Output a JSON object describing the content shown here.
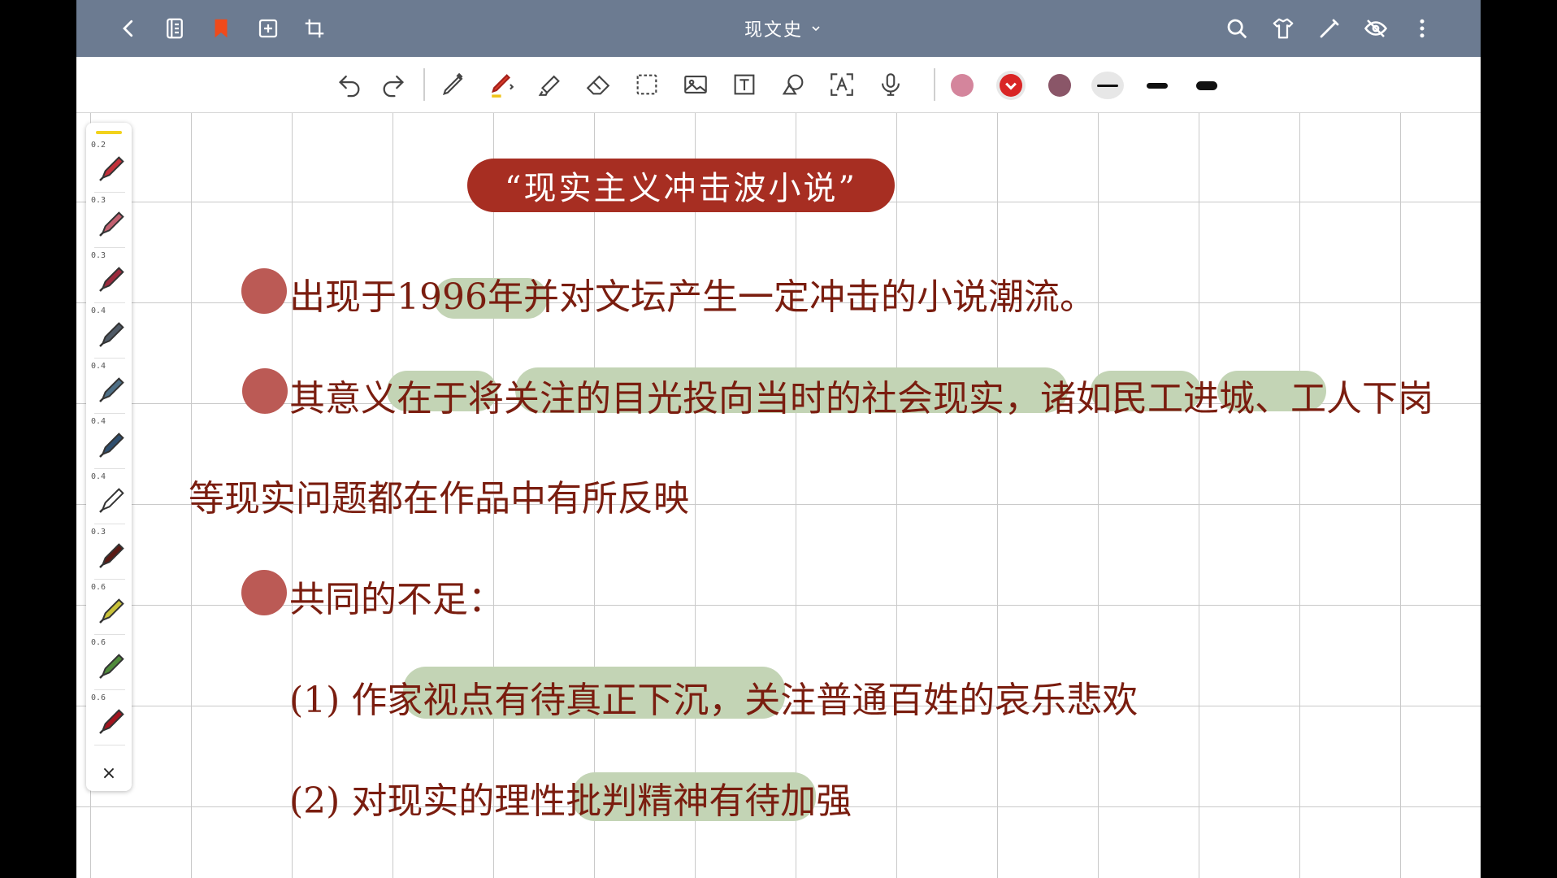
{
  "topbar": {
    "title": "现文史",
    "icons": [
      "back-icon",
      "notebook-icon",
      "bookmark-icon",
      "add-page-icon",
      "crop-icon",
      "search-icon",
      "theme-shirt-icon",
      "pen-edit-icon",
      "eye-hidden-icon",
      "more-icon"
    ]
  },
  "toolbar": {
    "tools": [
      "undo-icon",
      "redo-icon",
      "pencil-icon",
      "fountain-pen-icon",
      "highlighter-icon",
      "eraser-icon",
      "lasso-select-icon",
      "image-icon",
      "text-box-icon",
      "shape-icon",
      "ocr-text-icon",
      "microphone-icon"
    ],
    "colors": [
      "#d4859c",
      "#d92525",
      "#8a5668"
    ],
    "selected_color": "#d92525",
    "stroke_widths": [
      "thin",
      "medium",
      "thick"
    ]
  },
  "pen_panel": {
    "pens": [
      {
        "size": "0.2",
        "color": "#c2303a"
      },
      {
        "size": "0.3",
        "color": "#c26070"
      },
      {
        "size": "0.3",
        "color": "#9b2a3d"
      },
      {
        "size": "0.4",
        "color": "#4f5a66"
      },
      {
        "size": "0.4",
        "color": "#4e6f86"
      },
      {
        "size": "0.4",
        "color": "#2e4e6e"
      },
      {
        "size": "0.4",
        "color": "#ffffff"
      },
      {
        "size": "0.3",
        "color": "#5a1a14"
      },
      {
        "size": "0.6",
        "color": "#c9c23a"
      },
      {
        "size": "0.6",
        "color": "#4f8a3a"
      },
      {
        "size": "0.6",
        "color": "#a3141e"
      }
    ],
    "close_label": "×"
  },
  "notes": {
    "title": "“现实主义冲击波小说”",
    "line1": "出现于1996年并对文坛产生一定冲击的小说潮流。",
    "line2": "其意义在于将关注的目光投向当时的社会现实，诸如民工进城、工人下岗",
    "line3": "等现实问题都在作品中有所反映",
    "line4": "共同的不足：",
    "line5": "(1) 作家视点有待真正下沉，关注普通百姓的哀乐悲欢",
    "line6": "(2) 对现实的理性批判精神有待加强"
  }
}
